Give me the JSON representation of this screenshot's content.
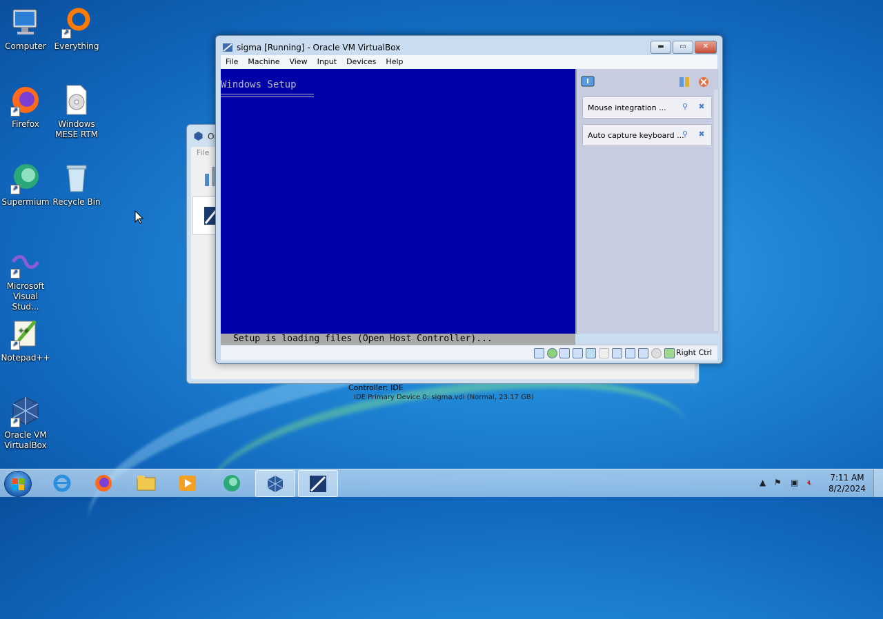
{
  "desktop": {
    "icons": [
      {
        "label": "Computer",
        "icon": "computer-icon"
      },
      {
        "label": "Everything",
        "icon": "everything-search-icon"
      },
      {
        "label": "Firefox",
        "icon": "firefox-icon"
      },
      {
        "label": "Windows MESE RTM",
        "icon": "disc-image-icon"
      },
      {
        "label": "Supermium",
        "icon": "supermium-browser-icon"
      },
      {
        "label": "Recycle Bin",
        "icon": "recycle-bin-icon"
      },
      {
        "label": "Microsoft Visual Stud...",
        "icon": "visual-studio-icon"
      },
      {
        "label": "Notepad++",
        "icon": "notepad-plus-plus-icon"
      },
      {
        "label": "Oracle VM VirtualBox",
        "icon": "virtualbox-icon"
      }
    ]
  },
  "manager_window": {
    "title": "Or",
    "menu_file": "File",
    "details_controller": "Controller: IDE",
    "details_device": "IDE Primary Device 0:      sigma.vdi (Normal, 23.17 GB)"
  },
  "vm_window": {
    "title": "sigma [Running] - Oracle VM VirtualBox",
    "menu": [
      "File",
      "Machine",
      "View",
      "Input",
      "Devices",
      "Help"
    ],
    "screen_header": "Windows Setup",
    "screen_status": "Setup is loading files (Open Host Controller)...",
    "notifications": [
      {
        "text": "Mouse integration ..."
      },
      {
        "text": "Auto capture keyboard ..."
      }
    ],
    "host_key": "Right Ctrl"
  },
  "taskbar": {
    "items": [
      "internet-explorer-icon",
      "firefox-icon",
      "file-explorer-icon",
      "media-player-icon",
      "supermium-icon",
      "virtualbox-icon",
      "windows-xp-vm-icon"
    ],
    "clock_time": "7:11 AM",
    "clock_date": "8/2/2024"
  },
  "colors": {
    "vm_screen_bg": "#0000a8",
    "vm_text": "#b8b8b8",
    "status_bar_bg": "#a8a8a8"
  }
}
